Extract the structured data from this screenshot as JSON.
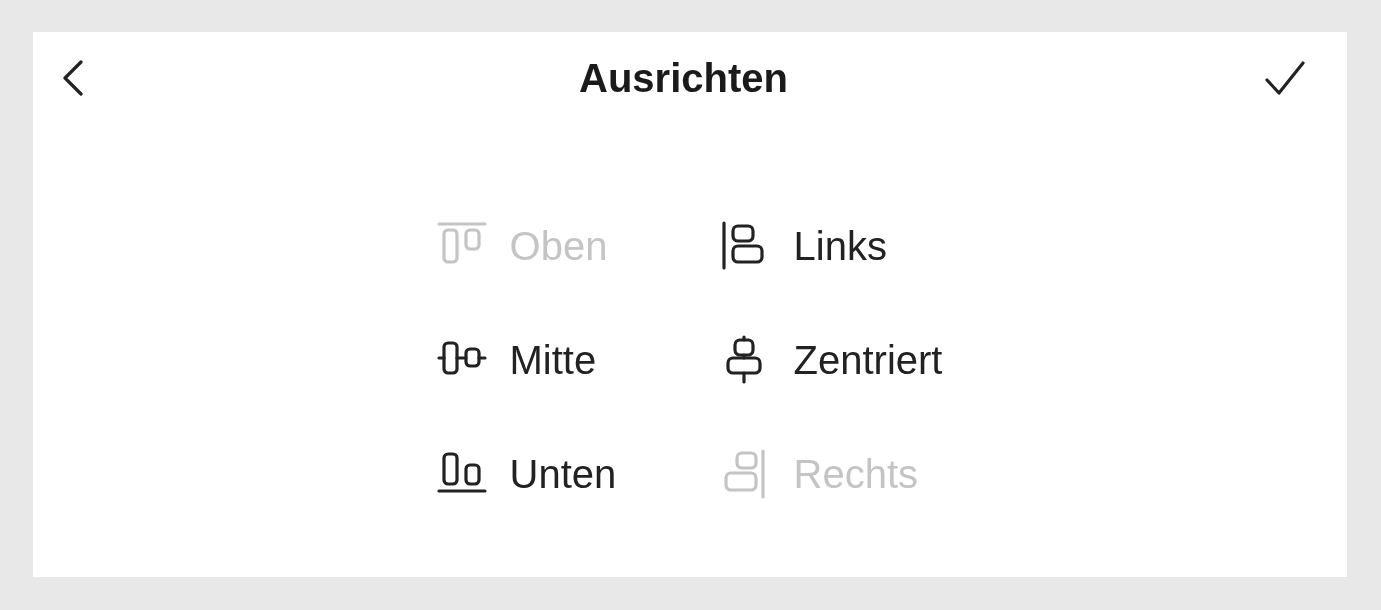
{
  "header": {
    "title": "Ausrichten"
  },
  "items": [
    {
      "label": "Oben",
      "kind": "top",
      "disabled": true
    },
    {
      "label": "Links",
      "kind": "left",
      "disabled": false
    },
    {
      "label": "Mitte",
      "kind": "middle",
      "disabled": false
    },
    {
      "label": "Zentriert",
      "kind": "center",
      "disabled": false
    },
    {
      "label": "Unten",
      "kind": "bottom",
      "disabled": false
    },
    {
      "label": "Rechts",
      "kind": "right",
      "disabled": true
    }
  ]
}
